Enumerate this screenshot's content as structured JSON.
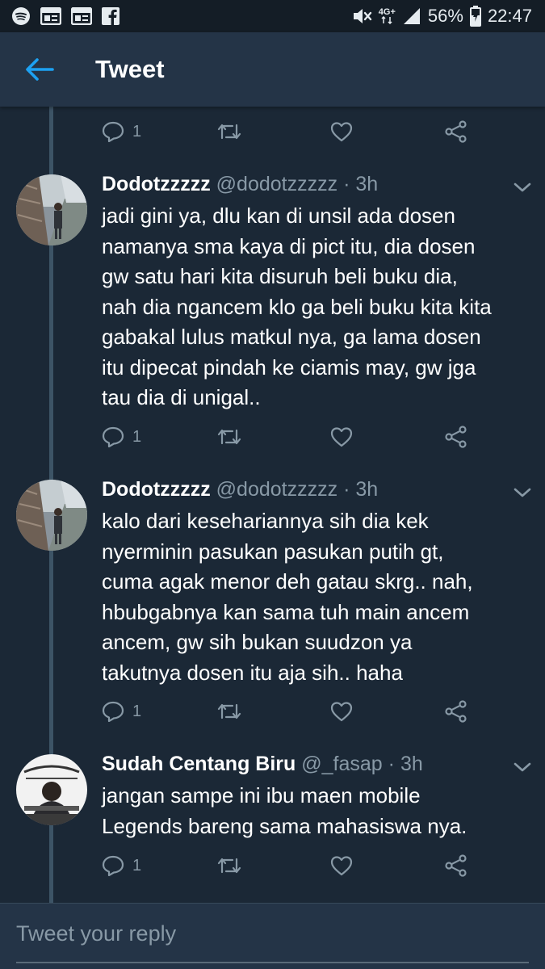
{
  "status_bar": {
    "battery": "56%",
    "time": "22:47",
    "network": "4G+"
  },
  "header": {
    "title": "Tweet"
  },
  "top_partial_actions": {
    "reply_count": "1"
  },
  "tweets": [
    {
      "name": "Dodotzzzzz",
      "handle": "@dodotzzzzz",
      "separator": "·",
      "time": "3h",
      "lines": [
        "jadi gini ya, dlu kan di unsil ada dosen",
        "namanya sma kaya di pict itu, dia dosen",
        "gw satu hari kita disuruh beli buku dia,",
        "nah dia ngancem klo ga beli buku kita kita",
        "gabakal lulus matkul nya, ga lama dosen",
        "itu dipecat pindah ke ciamis may, gw jga",
        "tau dia di unigal.."
      ],
      "reply_count": "1"
    },
    {
      "name": "Dodotzzzzz",
      "handle": "@dodotzzzzz",
      "separator": "·",
      "time": "3h",
      "lines": [
        "kalo dari kesehariannya sih dia kek",
        "nyerminin pasukan pasukan putih gt,",
        "cuma agak menor deh gatau skrg.. nah,",
        "hbubgabnya kan sama tuh main ancem",
        "ancem, gw sih bukan suudzon ya",
        "takutnya dosen itu aja sih.. haha"
      ],
      "reply_count": "1"
    },
    {
      "name": "Sudah Centang Biru",
      "handle": "@_fasap",
      "separator": "·",
      "time": "3h",
      "lines": [
        "jangan sampe ini ibu maen mobile",
        "Legends bareng sama mahasiswa nya."
      ],
      "reply_count": "1"
    }
  ],
  "reply_bar": {
    "placeholder": "Tweet your reply"
  },
  "colors": {
    "background": "#1b2836",
    "app_bar": "#243447",
    "status_bar": "#141d26",
    "accent": "#1da1f2",
    "secondary_text": "#8899a6",
    "thread_line": "#3d5466"
  }
}
